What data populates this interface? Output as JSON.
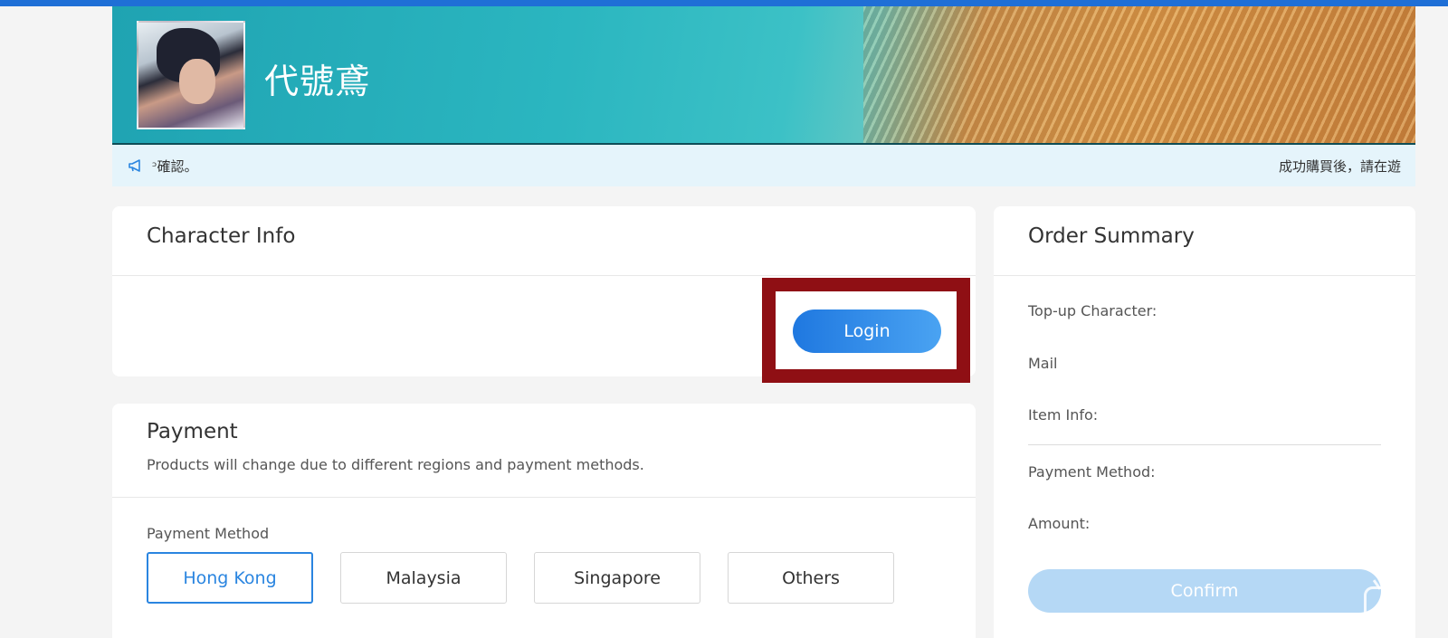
{
  "banner": {
    "game_title": "代號鳶"
  },
  "notice": {
    "left_text": "ᵓ確認。",
    "right_text": "成功購買後，請在遊"
  },
  "character_info": {
    "title": "Character Info",
    "login_label": "Login"
  },
  "payment": {
    "title": "Payment",
    "subtitle": "Products will change due to different regions and payment methods.",
    "method_label": "Payment Method",
    "methods": [
      "Hong Kong",
      "Malaysia",
      "Singapore",
      "Others"
    ],
    "selected": "Hong Kong"
  },
  "order_summary": {
    "title": "Order Summary",
    "top_up_character": "Top-up Character:",
    "mail": "Mail",
    "item_info": "Item Info:",
    "payment_method": "Payment Method:",
    "amount": "Amount:",
    "confirm_label": "Confirm"
  },
  "colors": {
    "accent": "#1f78e0",
    "highlight_frame": "#8f0f14",
    "confirm_disabled": "#b5d8f5",
    "notice_bg": "#e5f4fb"
  },
  "icons": [
    "megaphone-icon",
    "video-player-icon"
  ]
}
